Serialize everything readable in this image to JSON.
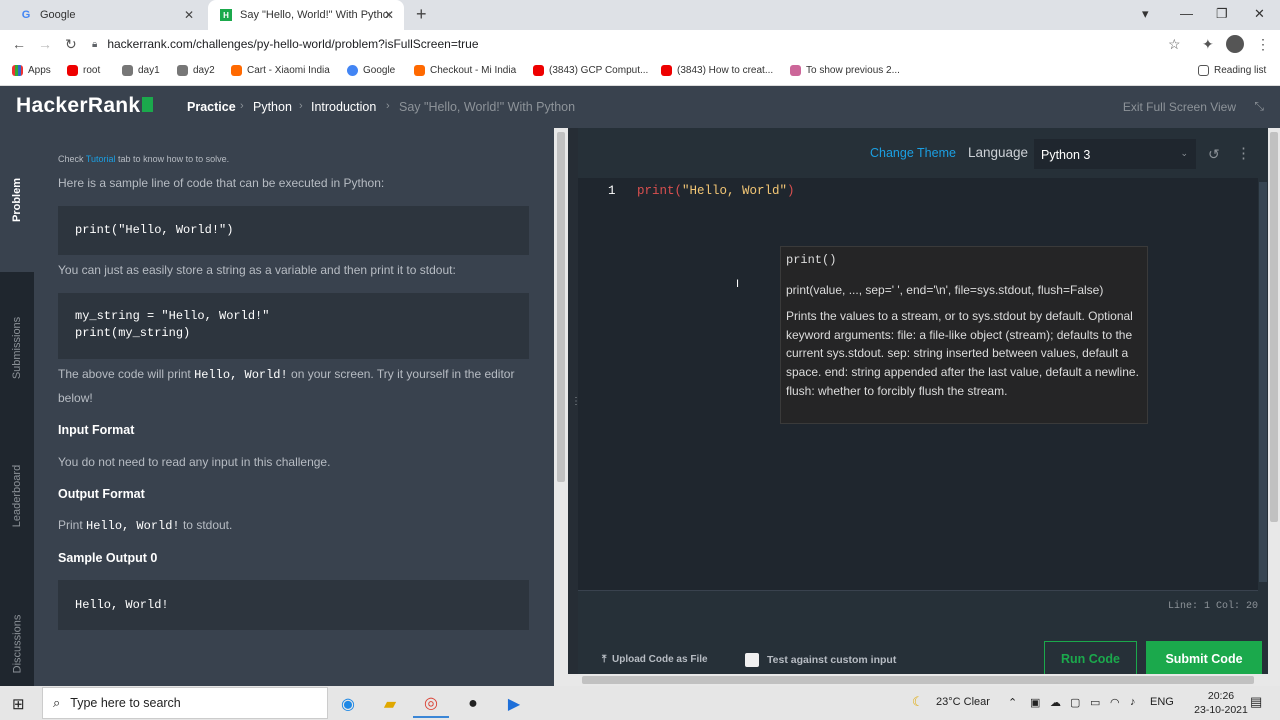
{
  "browser": {
    "tabs": [
      {
        "title": "Google",
        "favicon": "G"
      },
      {
        "title": "Say \"Hello, World!\" With Python",
        "favicon": "H"
      }
    ],
    "url": "hackerrank.com/challenges/py-hello-world/problem?isFullScreen=true",
    "bookmarks": [
      "Apps",
      "root",
      "day1",
      "day2",
      "Cart - Xiaomi India",
      "Google",
      "Checkout - Mi India",
      "(3843) GCP Comput...",
      "(3843) How to creat...",
      "To show previous 2..."
    ],
    "reading_list": "Reading list"
  },
  "header": {
    "logo": "HackerRank",
    "breadcrumb": [
      "Practice",
      "Python",
      "Introduction",
      "Say \"Hello, World!\" With Python"
    ],
    "exit_fullscreen": "Exit Full Screen View"
  },
  "side_tabs": [
    "Problem",
    "Submissions",
    "Leaderboard",
    "Discussions"
  ],
  "problem": {
    "tutorial_note_pre": "Check ",
    "tutorial_link": "Tutorial",
    "tutorial_note_post": " tab to know how to to solve.",
    "intro": "Here is a sample line of code that can be executed in Python:",
    "code1": "print(\"Hello, World!\")",
    "para2": "You can just as easily store a string as a variable and then print it to stdout:",
    "code2": "my_string = \"Hello, World!\"\nprint(my_string)",
    "para3_pre": "The above code will print ",
    "para3_code": "Hello, World!",
    "para3_post": " on your screen. Try it yourself in the editor",
    "para3_line2": "below!",
    "input_heading": "Input Format",
    "input_text": "You do not need to read any input in this challenge.",
    "output_heading": "Output Format",
    "output_pre": "Print ",
    "output_code": "Hello, World!",
    "output_post": " to stdout.",
    "sample_heading": "Sample Output 0",
    "sample_code": "Hello, World!"
  },
  "editor": {
    "change_theme": "Change Theme",
    "language_label": "Language",
    "language_value": "Python 3",
    "line_number": "1",
    "code_fn": "print(",
    "code_str": "\"Hello, World\"",
    "code_close": ")",
    "tooltip_sig": "print()",
    "tooltip_full": "print(value, ..., sep=' ', end='\\n', file=sys.stdout, flush=False)",
    "tooltip_doc": "Prints the values to a stream, or to sys.stdout by default. Optional keyword arguments: file: a file-like object (stream); defaults to the current sys.stdout. sep: string inserted between values, default a space. end: string appended after the last value, default a newline. flush: whether to forcibly flush the stream.",
    "status": "Line: 1 Col: 20",
    "upload": "Upload Code as File",
    "custom_input": "Test against custom input",
    "run": "Run Code",
    "submit": "Submit Code"
  },
  "taskbar": {
    "search_placeholder": "Type here to search",
    "weather": "23°C  Clear",
    "lang": "ENG",
    "time": "20:26",
    "date": "23-10-2021"
  },
  "colors": {
    "accent_green": "#1ba94c",
    "link_blue": "#1b9fe2",
    "header_bg": "#39424e"
  }
}
